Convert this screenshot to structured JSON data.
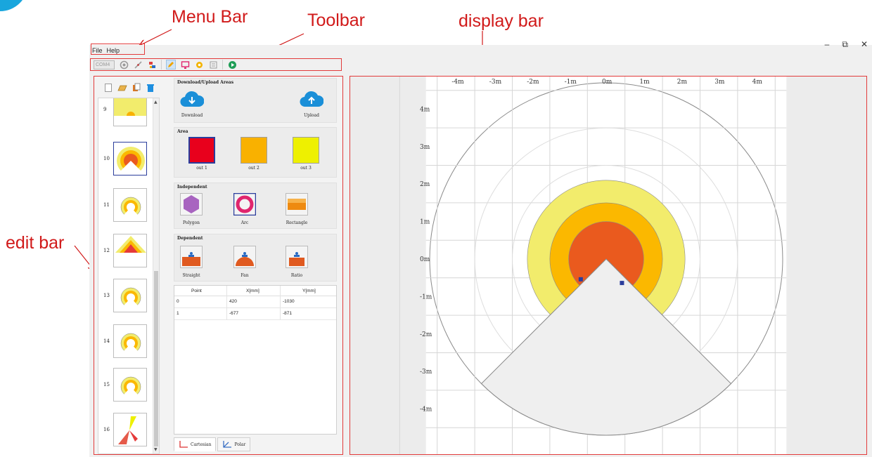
{
  "annotations": {
    "menu_bar": "Menu Bar",
    "toolbar": "Toolbar",
    "display_bar": "display bar",
    "edit_bar": "edit bar"
  },
  "menu": [
    "File",
    "Help"
  ],
  "window_controls": {
    "minimize": "–",
    "restore": "⧉",
    "close": "✕"
  },
  "toolbar": {
    "port_select": "COM4"
  },
  "thumbnails": [
    {
      "num": "9",
      "selected": false
    },
    {
      "num": "10",
      "selected": true
    },
    {
      "num": "11",
      "selected": false
    },
    {
      "num": "12",
      "selected": false
    },
    {
      "num": "13",
      "selected": false
    },
    {
      "num": "14",
      "selected": false
    },
    {
      "num": "15",
      "selected": false
    },
    {
      "num": "16",
      "selected": false
    }
  ],
  "groups": {
    "download_upload": {
      "title": "Download/Upload Areas",
      "download": "Download",
      "upload": "Upload"
    },
    "area": {
      "title": "Area",
      "items": [
        "out 1",
        "out 2",
        "out 3"
      ]
    },
    "independent": {
      "title": "Independent",
      "items": [
        "Polygon",
        "Arc",
        "Rectangle"
      ]
    },
    "dependent": {
      "title": "Dependent",
      "items": [
        "Straight",
        "Fan",
        "Ratio"
      ]
    }
  },
  "points_table": {
    "headers": [
      "Point",
      "X[mm]",
      "Y[mm]"
    ],
    "rows": [
      {
        "point": "0",
        "x": "420",
        "y": "-1030"
      },
      {
        "point": "1",
        "x": "-677",
        "y": "-871"
      }
    ]
  },
  "tabs": [
    "Cartesian",
    "Polar"
  ],
  "colors": {
    "out1": "#e8001c",
    "out2": "#f9b100",
    "out3": "#eef000",
    "zone_inner": "#ea5a1e",
    "zone_mid": "#fbb800",
    "zone_outer": "#f2ec6c",
    "annotation": "#d11a1a",
    "point_marker": "#2b3d9c"
  },
  "display": {
    "x_ticks": [
      "-4m",
      "-3m",
      "-2m",
      "-1m",
      "0m",
      "1m",
      "2m",
      "3m",
      "4m"
    ],
    "y_ticks": [
      "4m",
      "3m",
      "2m",
      "1m",
      "0m",
      "-1m",
      "-2m",
      "-3m",
      "-4m"
    ],
    "range_m": 4.7,
    "zone_radii_m": [
      1.0,
      1.5,
      2.1
    ],
    "blind_sector_half_angle_deg": 45
  }
}
